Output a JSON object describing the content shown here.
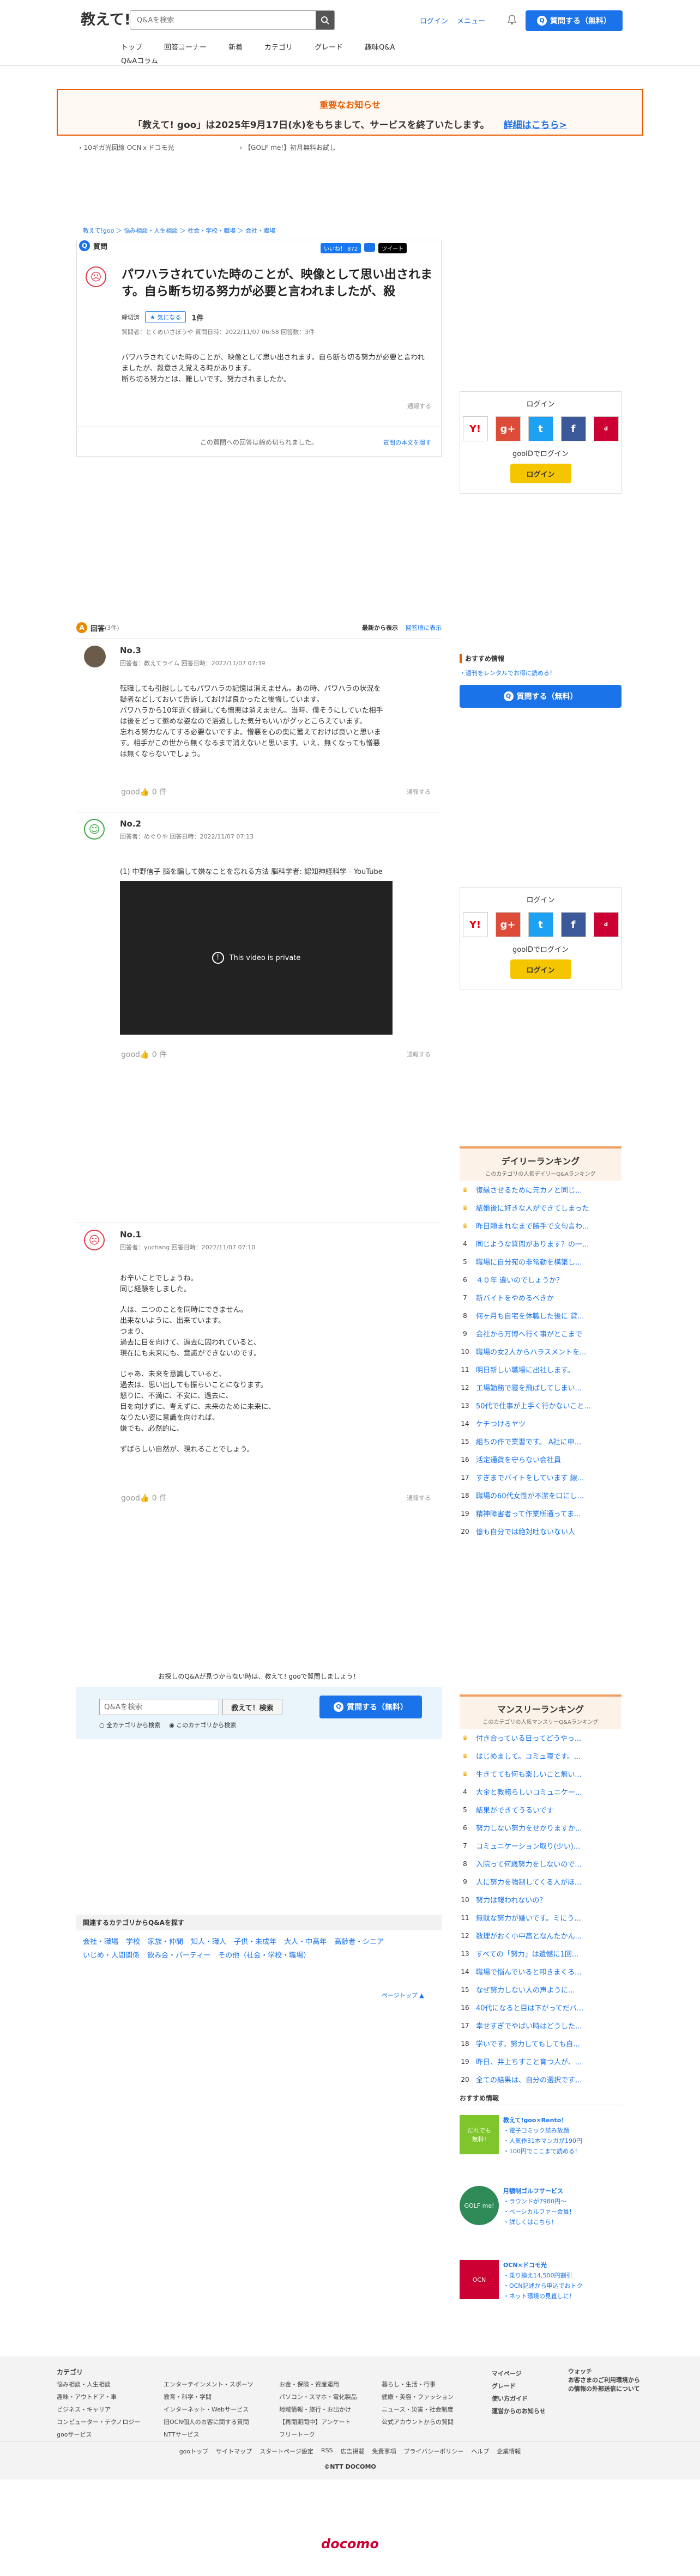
{
  "header": {
    "logo_text": "教えて!",
    "logo_brand": "goo",
    "search_placeholder": "Q&Aを検索",
    "login": "ログイン",
    "menu": "メニュー",
    "ask_button": "質問する（無料）",
    "nav": [
      "トップ",
      "回答コーナー",
      "新着",
      "カテゴリ",
      "グレード",
      "趣味Q&A"
    ],
    "nav2": "Q&Aコラム"
  },
  "notice": {
    "title": "重要なお知らせ",
    "text": "「教えて! goo」は2025年9月17日(水)をもちまして、サービスを終了いたします。",
    "link": "詳細はこちら>"
  },
  "ads": [
    "10ギガ光回線 OCNｘドコモ光",
    "【GOLF me!】初月無料お試し"
  ],
  "breadcrumb": "教えて!goo ＞ 悩み相談・人生相談 ＞ 社会・学校・職場 ＞ 会社・職場",
  "question": {
    "label": "質問",
    "title": "パワハラされていた時のことが、映像として思い出されます。自ら断ち切る努力が必要と言われましたが、殺",
    "status": "締切済",
    "good_label": "気になる",
    "good_count": "1件",
    "meta": "質問者：とくめいさぼうや  質問日時：2022/11/07 06:58  回答数：3件",
    "body": [
      "パワハラされていた時のことが、映像として思い出されます。自ら断ち切る努力が必要と言われましたが、殺意さえ覚える時があります。",
      "断ち切る努力とは、難しいです。努力されましたか。"
    ],
    "report": "通報する",
    "closed": "この質問への回答は締め切られました。",
    "show_body": "質問の本文を隠す",
    "share": [
      "いいね！ 872",
      "ツイート"
    ]
  },
  "sidebar": {
    "login_title": "ログイン",
    "goo_id": "gooIDでログイン",
    "login_button": "ログイン",
    "recommend_title": "おすすめ情報",
    "recommend_link": "・週刊をレンタルでお得に読める！",
    "ask_button": "質問する（無料）"
  },
  "answers_head": {
    "label": "回答",
    "count": "(3件)",
    "sort_new": "最新から表示",
    "sort_old": "回答順に表示"
  },
  "answers": [
    {
      "no": "No.3",
      "meta": "回答者：教えてライム  回答日時：2022/11/07 07:39",
      "body": [
        "転職しても引越ししてもパワハラの記憶は消えません。あの時、パワハラの状況を",
        "疑者などしておいて告訴しておけば良かったと後悔しています。",
        "パワハラから10年近く経過しても憎悪は消えません。当時、僕そうにしていた相手",
        "は後をどって懲めな姿なので浴返しした気分もいいがグッとこらえています。",
        "忘れる努力なんてする必要ないですよ。憎悪を心の奥に蓄えておけば良いと思いま",
        "す。相手がこの世から無くなるまで消えないと思います。いえ、無くなっても憎悪",
        "は無くならないでしょう。"
      ],
      "good": "0 件",
      "report": "通報する"
    },
    {
      "no": "No.2",
      "meta": "回答者：めぐりや  回答日時：2022/11/07 07:13",
      "link": "(1) 中野信子 脳を騙して嫌なことを忘れる方法 脳科学者: 認知神経科学 - YouTube",
      "video": "This video is private",
      "good": "0 件",
      "report": "通報する"
    },
    {
      "no": "No.1",
      "meta": "回答者：yuchang  回答日時：2022/11/07 07:10",
      "body": [
        "お辛いことでしょうね。",
        "同じ経験をしました。",
        "",
        "人は、二つのことを同時にできません。",
        "出来ないように、出来ています。",
        "つまり、",
        "過去に目を向けて、過去に囚われていると、",
        "現在にも未来にも、意識ができないのです。",
        "",
        "じゃあ、未来を意識していると、",
        "過去は、思い出しても振らいことになります。",
        "怒りに、不満に、不安に、過去に、",
        "目を向けずに、考えずに、未来のために未来に、",
        "なりたい姿に意識を向ければ、",
        "嫌でも、必然的に、",
        "",
        "ずばらしい自然が、現れることでしょう。"
      ],
      "good": "0 件",
      "report": "通報する"
    }
  ],
  "daily_ranking": {
    "title": "デイリーランキング",
    "subtitle": "このカテゴリの人気デイリーQ&Aランキング",
    "items": [
      "復縁させるために元カノと同じ...",
      "結婚後に好きな人ができてしまった",
      "昨日頼まれなまで勝手で文句言わ...",
      "同じような質問があります？の一...",
      "職場に自分宛の非常勤を構築し...",
      "４０年 違いのでしょうか？",
      "新バイトをやめるべきか",
      "何ヶ月も自宅を休職した後に 貸...",
      "会社から万博へ行く事がとこまで",
      "職場の女2人からハラスメントを...",
      "明日新しい職場に出社します。",
      "工場勤務で寝を飛ばしてしまい...",
      "50代で仕事が上手く行かないこと...",
      "ケチつけるヤツ",
      "組ちの作で業習です。 A社に申...",
      "活定通貨を守らない会社員",
      "すぎまでバイトをしています 線...",
      "職場の60代女性が不潔を口にし...",
      "精神障害者って作業所通ってま...",
      "億も自分では絶対吐ないない人"
    ]
  },
  "manslee_ranking": {
    "title": "マンスリーランキング",
    "subtitle": "このカテゴリの人気マンスリーQ&Aランキング",
    "items": [
      "付き合っている目ってどうやっ...",
      "はじめまして。コミュ障です。...",
      "生きてても何も楽しいこと無い...",
      "大金と教務らしいコミュニケー...",
      "結果ができてうるいです",
      "努力しない努力をせかりますか...",
      "コミュニケーション取り(少い)...",
      "入院って何歳努力をしないので...",
      "人に努力を強制してくる人がほ...",
      "努力は報われないの？",
      "無駄な努力が嫌いです。ミにう...",
      "数理がおく小中高となんたかん...",
      "すべての「努力」は遺憾に1回...",
      "職場で悩んでいると叩きまくる...",
      "なぜ努力しない人の声ように...",
      "40代になると目は下がってだバ...",
      "幸せすぎでやばい時はどうした...",
      "学いです。努力してもしても自...",
      "昨日、井上ちすこと育つ人が、...",
      "全ての結果は、自分の選択です..."
    ]
  },
  "ads_sidebar": {
    "title": "おすすめ情報",
    "blocks": [
      {
        "title": "教えて!goo×Rento！",
        "lines": [
          "・電子コミック読み放題",
          "・人気作31本マンガが190円",
          "・100円でここまで読める！"
        ]
      },
      {
        "title": "月額制ゴルフサービス",
        "lines": [
          "・ラウンドが7980円〜",
          "・ベーシカルファー会員！",
          "・詳しくはこちら！"
        ]
      },
      {
        "title": "OCN×ドコモ光",
        "lines": [
          "・乗り換え14,500円割引",
          "・OCN記述から申込でおトク",
          "・ネット環境の見直しに！"
        ]
      }
    ]
  },
  "bottom_search": {
    "prompt": "お探しのQ&Aが見つからない時は、教えて! gooで質問しましょう！",
    "placeholder": "Q&Aを検索",
    "search_button": "教えて！検索",
    "ask_button": "質問する（無料）",
    "radio1": "全カテゴリから検索",
    "radio2": "このカテゴリから検索"
  },
  "related": {
    "title": "関連するカテゴリからQ&Aを探す",
    "links": [
      "会社・職場",
      "学校",
      "家族・仲間",
      "知人・職人",
      "子供・未成年",
      "大人・中高年",
      "高齢者・シニア",
      "いじめ・人間関係",
      "飲み会・パーティー",
      "その他（社会・学校・職場）"
    ]
  },
  "pagetop": "ページトップ",
  "footer": {
    "category_title": "カテゴリ",
    "col1": [
      "悩み相談・人生相談",
      "趣味・アウトドア・車",
      "ビジネス・キャリア",
      "コンピューター・テクノロジー",
      "gooサービス"
    ],
    "col2": [
      "エンターテインメント・スポーツ",
      "教育・科学・学問",
      "インターネット・Webサービス",
      "旧OCN個人のお客に関する質問",
      "NTTサービス"
    ],
    "col3": [
      "お金・保険・資産運用",
      "パソコン・スマホ・電化製品",
      "地域情報・旅行・お出かけ",
      "【再開期間中】アンケート",
      "フリートーク"
    ],
    "col4": [
      "暮らし・生活・行事",
      "健康・美容・ファッション",
      "ニュース・災害・社会制度",
      "公式アカウントからの質問"
    ],
    "col5": [
      "マイページ",
      "グレード",
      "使い方ガイド",
      "運営からのお知らせ"
    ],
    "col6": [
      "ウォッチ",
      "お客さまのご利用環境からの情報の外部送信について"
    ],
    "links": [
      "gooトップ",
      "サイトマップ",
      "スタートページ設定",
      "RSS",
      "広告掲載",
      "免責事項",
      "プライバシーポリシー",
      "ヘルプ",
      "企業情報"
    ],
    "copyright": "©NTT DOCOMO",
    "brand": "docomo"
  }
}
